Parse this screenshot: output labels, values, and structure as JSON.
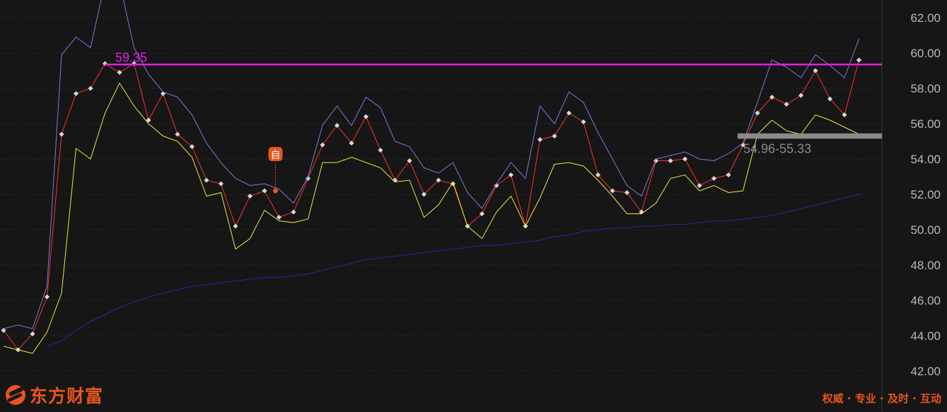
{
  "chart_data": {
    "type": "line",
    "y_ticks": [
      "62.00",
      "60.00",
      "58.00",
      "56.00",
      "54.00",
      "52.00",
      "50.00",
      "48.00",
      "46.00",
      "44.00",
      "42.00"
    ],
    "ylim": [
      41.2,
      63.0
    ],
    "grid": true,
    "series": [
      {
        "color": "#ff3030",
        "markers": true,
        "values": [
          44.3,
          43.2,
          44.1,
          46.2,
          55.4,
          57.7,
          58.0,
          59.4,
          58.9,
          59.4,
          56.2,
          57.7,
          55.4,
          54.7,
          52.8,
          52.6,
          50.2,
          51.9,
          52.2,
          50.7,
          51.0,
          52.9,
          54.8,
          55.9,
          54.9,
          56.4,
          54.5,
          52.8,
          53.9,
          52.0,
          52.8,
          52.6,
          50.2,
          50.9,
          52.5,
          53.1,
          50.2,
          55.1,
          55.3,
          56.6,
          56.1,
          53.1,
          52.2,
          52.1,
          51.0,
          53.9,
          53.9,
          54.0,
          52.5,
          52.9,
          53.1,
          54.8,
          56.6,
          57.5,
          57.1,
          57.6,
          59.0,
          57.4,
          56.5,
          59.6
        ]
      },
      {
        "color": "#7b7bd8",
        "markers": false,
        "values": [
          44.4,
          44.6,
          44.4,
          46.8,
          59.9,
          60.9,
          60.3,
          64.0,
          64.0,
          60.3,
          58.8,
          57.8,
          57.5,
          56.5,
          54.9,
          53.8,
          52.9,
          52.5,
          52.6,
          52.3,
          51.5,
          53.0,
          55.9,
          57.0,
          55.9,
          57.5,
          56.9,
          55.0,
          54.7,
          53.5,
          53.2,
          53.8,
          52.1,
          51.2,
          52.6,
          53.8,
          52.9,
          57.0,
          56.0,
          57.8,
          57.2,
          55.5,
          54.0,
          52.5,
          51.9,
          54.0,
          54.2,
          54.4,
          54.0,
          53.9,
          54.3,
          54.9,
          57.2,
          59.6,
          59.2,
          58.6,
          59.9,
          59.3,
          58.6,
          60.8
        ]
      },
      {
        "color": "#e8e848",
        "markers": false,
        "values": [
          43.4,
          43.2,
          43.0,
          44.2,
          46.4,
          54.6,
          54.0,
          56.6,
          58.3,
          57.0,
          56.0,
          55.3,
          55.0,
          54.1,
          51.9,
          52.1,
          48.9,
          49.5,
          51.1,
          50.5,
          50.4,
          50.6,
          53.8,
          53.8,
          54.1,
          53.8,
          53.5,
          52.7,
          52.8,
          50.7,
          51.4,
          52.7,
          50.2,
          49.5,
          51.0,
          51.9,
          50.2,
          51.8,
          53.7,
          53.8,
          53.6,
          52.8,
          51.9,
          50.9,
          50.9,
          51.5,
          52.9,
          53.1,
          52.2,
          52.5,
          52.1,
          52.2,
          55.4,
          56.2,
          55.6,
          55.4,
          56.5,
          56.2,
          55.8,
          55.4
        ]
      },
      {
        "color": "#1d2aa0",
        "markers": false,
        "values": [
          null,
          null,
          null,
          43.4,
          43.7,
          44.3,
          44.8,
          45.2,
          45.6,
          45.9,
          46.2,
          46.4,
          46.6,
          46.8,
          46.9,
          47.0,
          47.1,
          47.2,
          47.3,
          47.3,
          47.4,
          47.5,
          47.7,
          47.9,
          48.1,
          48.3,
          48.4,
          48.5,
          48.6,
          48.7,
          48.8,
          48.9,
          49.0,
          49.1,
          49.1,
          49.2,
          49.3,
          49.4,
          49.6,
          49.7,
          49.9,
          50.0,
          50.1,
          50.1,
          50.2,
          50.2,
          50.3,
          50.3,
          50.4,
          50.5,
          50.5,
          50.6,
          50.7,
          50.8,
          51.0,
          51.2,
          51.4,
          51.6,
          51.8,
          52.0
        ]
      }
    ],
    "annotations": {
      "resistance": {
        "value": 59.35,
        "label": "59.35",
        "color": "#e020e0"
      },
      "support_band": {
        "low": 55.15,
        "high": 55.45,
        "label": "54.96-55.33",
        "color": "#8a8a8a"
      },
      "marker": {
        "label": "自",
        "index": 19,
        "value": 52.2,
        "color": "#e8551d"
      }
    }
  },
  "brand": {
    "name": "东方财富",
    "slogan": "权威 · 专业 · 及时 · 互动"
  }
}
